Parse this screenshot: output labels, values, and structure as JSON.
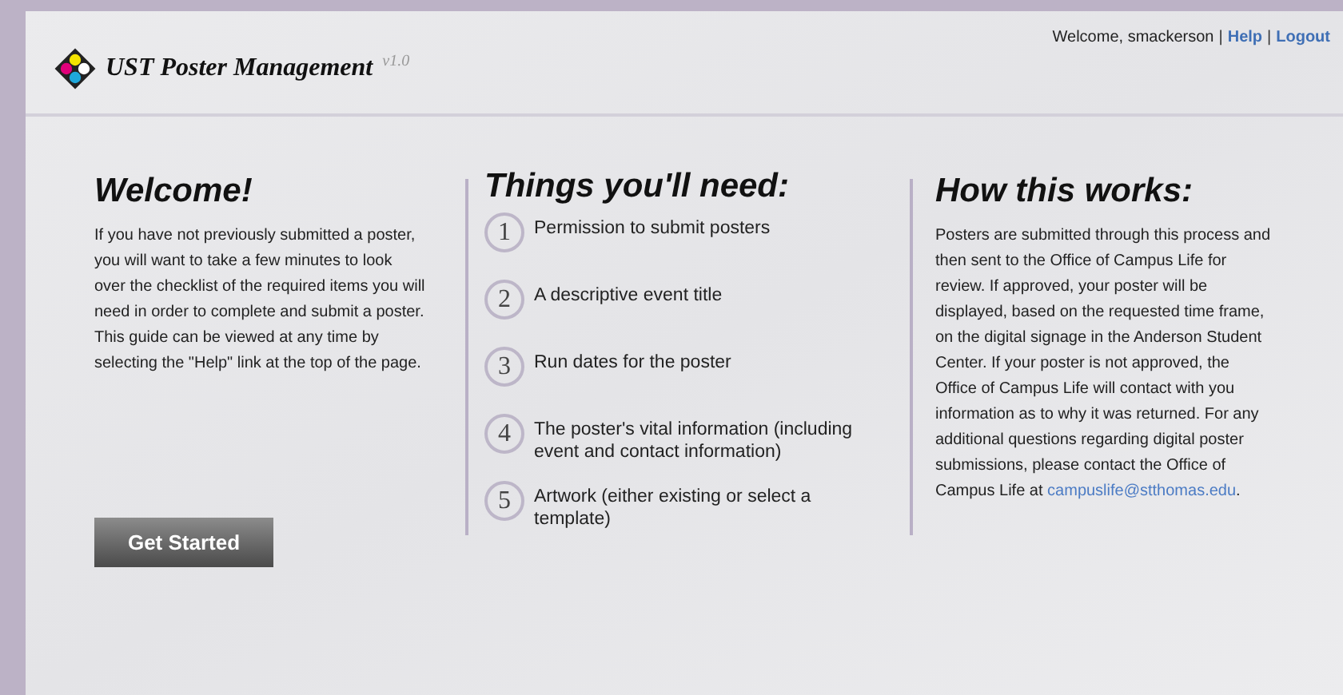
{
  "header": {
    "title": "UST Poster Management",
    "version": "v1.0"
  },
  "user_bar": [
    {
      "kind": "text",
      "text": "Welcome, smackerson"
    },
    {
      "kind": "sep",
      "text": "|"
    },
    {
      "kind": "link",
      "text": "Help"
    },
    {
      "kind": "sep",
      "text": "|"
    },
    {
      "kind": "link",
      "text": "Logout"
    }
  ],
  "welcome": {
    "heading": "Welcome!",
    "body": "If you have not previously submitted a poster, you will want to take a few minutes to look over the checklist of the required items you will need in order to complete and submit a poster. This guide can be viewed at any time by selecting the \"Help\" link at the top of the page.",
    "button": "Get Started"
  },
  "needs": {
    "heading": "Things you'll need:",
    "items": [
      {
        "number": "1",
        "text": "Permission to submit posters"
      },
      {
        "number": "2",
        "text": "A descriptive event title"
      },
      {
        "number": "3",
        "text": "Run dates for the poster"
      },
      {
        "number": "4",
        "text": "The poster's vital information (including event and contact information)"
      },
      {
        "number": "5",
        "text": "Artwork (either existing or select a template)"
      }
    ]
  },
  "how": {
    "heading": "How this works:",
    "body": "Posters are submitted through this process and then sent to the Office of Campus Life for review. If approved, your poster will be displayed, based on the requested time frame, on the digital signage in the Anderson Student Center. If your poster is not approved, the Office of Campus Life will contact with you information as to why it was returned. For any additional questions regarding digital poster submissions, please contact the Office of Campus Life at ",
    "email": "campuslife@stthomas.edu",
    "after": "."
  }
}
